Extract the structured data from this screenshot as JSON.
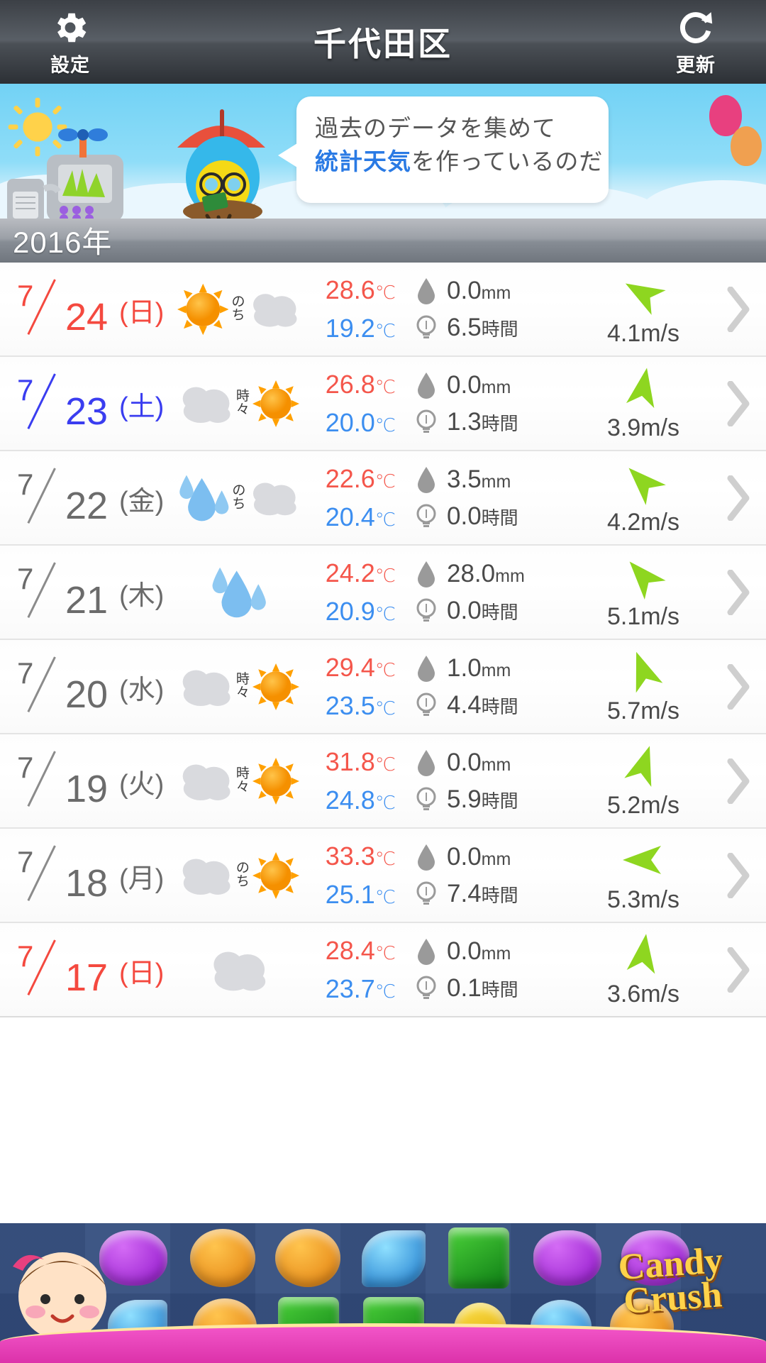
{
  "header": {
    "settings_label": "設定",
    "settings_icon": "gear-icon",
    "title": "千代田区",
    "refresh_label": "更新",
    "refresh_icon": "refresh-icon"
  },
  "banner": {
    "line1": "過去のデータを集めて",
    "line2_highlight": "統計天気",
    "line2_rest": "を作っているのだ",
    "highlight_color": "#2a7ae4"
  },
  "year_header": {
    "label": "2016年"
  },
  "columns": {
    "precip_icon": "raindrop-icon",
    "sunshine_icon": "lightbulb-icon",
    "wind_icon": "wind-arrow-icon",
    "chevron_icon": "chevron-right-icon"
  },
  "rows": [
    {
      "month": "7",
      "day": "24",
      "dow": "(日)",
      "dow_type": "red",
      "weather": [
        "sun",
        "cloud"
      ],
      "conj": "のち",
      "temp_high": "28.6",
      "temp_low": "19.2",
      "temp_unit": "℃",
      "precip": "0.0",
      "precip_unit": "mm",
      "sunshine": "6.5",
      "sunshine_unit": "時間",
      "wind": "4.1",
      "wind_unit": "m/s",
      "wind_dir_deg": 300
    },
    {
      "month": "7",
      "day": "23",
      "dow": "(土)",
      "dow_type": "blue",
      "weather": [
        "cloud",
        "sun"
      ],
      "conj": "時々",
      "temp_high": "26.8",
      "temp_low": "20.0",
      "temp_unit": "℃",
      "precip": "0.0",
      "precip_unit": "mm",
      "sunshine": "1.3",
      "sunshine_unit": "時間",
      "wind": "3.9",
      "wind_unit": "m/s",
      "wind_dir_deg": 10
    },
    {
      "month": "7",
      "day": "22",
      "dow": "(金)",
      "dow_type": "grey",
      "weather": [
        "rain",
        "cloud"
      ],
      "conj": "のち",
      "temp_high": "22.6",
      "temp_low": "20.4",
      "temp_unit": "℃",
      "precip": "3.5",
      "precip_unit": "mm",
      "sunshine": "0.0",
      "sunshine_unit": "時間",
      "wind": "4.2",
      "wind_unit": "m/s",
      "wind_dir_deg": 315
    },
    {
      "month": "7",
      "day": "21",
      "dow": "(木)",
      "dow_type": "grey",
      "weather": [
        "rain"
      ],
      "conj": "",
      "temp_high": "24.2",
      "temp_low": "20.9",
      "temp_unit": "℃",
      "precip": "28.0",
      "precip_unit": "mm",
      "sunshine": "0.0",
      "sunshine_unit": "時間",
      "wind": "5.1",
      "wind_unit": "m/s",
      "wind_dir_deg": 318
    },
    {
      "month": "7",
      "day": "20",
      "dow": "(水)",
      "dow_type": "grey",
      "weather": [
        "cloud",
        "sun"
      ],
      "conj": "時々",
      "temp_high": "29.4",
      "temp_low": "23.5",
      "temp_unit": "℃",
      "precip": "1.0",
      "precip_unit": "mm",
      "sunshine": "4.4",
      "sunshine_unit": "時間",
      "wind": "5.7",
      "wind_unit": "m/s",
      "wind_dir_deg": 340
    },
    {
      "month": "7",
      "day": "19",
      "dow": "(火)",
      "dow_type": "grey",
      "weather": [
        "cloud",
        "sun"
      ],
      "conj": "時々",
      "temp_high": "31.8",
      "temp_low": "24.8",
      "temp_unit": "℃",
      "precip": "0.0",
      "precip_unit": "mm",
      "sunshine": "5.9",
      "sunshine_unit": "時間",
      "wind": "5.2",
      "wind_unit": "m/s",
      "wind_dir_deg": 18
    },
    {
      "month": "7",
      "day": "18",
      "dow": "(月)",
      "dow_type": "grey",
      "weather": [
        "cloud",
        "sun"
      ],
      "conj": "のち",
      "temp_high": "33.3",
      "temp_low": "25.1",
      "temp_unit": "℃",
      "precip": "0.0",
      "precip_unit": "mm",
      "sunshine": "7.4",
      "sunshine_unit": "時間",
      "wind": "5.3",
      "wind_unit": "m/s",
      "wind_dir_deg": 270
    },
    {
      "month": "7",
      "day": "17",
      "dow": "(日)",
      "dow_type": "red",
      "weather": [
        "cloud"
      ],
      "conj": "",
      "temp_high": "28.4",
      "temp_low": "23.7",
      "temp_unit": "℃",
      "precip": "0.0",
      "precip_unit": "mm",
      "sunshine": "0.1",
      "sunshine_unit": "時間",
      "wind": "3.6",
      "wind_unit": "m/s",
      "wind_dir_deg": 8
    }
  ],
  "ad": {
    "title_line1": "Candy",
    "title_line2": "Crush",
    "name": "candy-crush-ad"
  }
}
